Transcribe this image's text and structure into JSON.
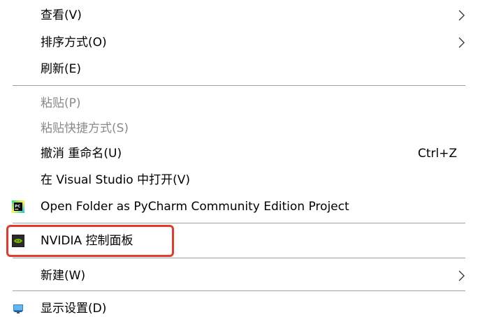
{
  "menu": {
    "items": [
      {
        "label": "查看(V)",
        "submenu": true
      },
      {
        "label": "排序方式(O)",
        "submenu": true
      },
      {
        "label": "刷新(E)"
      },
      {
        "label": "粘贴(P)",
        "disabled": true
      },
      {
        "label": "粘贴快捷方式(S)",
        "disabled": true
      },
      {
        "label": "撤消 重命名(U)",
        "shortcut": "Ctrl+Z"
      },
      {
        "label": "在 Visual Studio 中打开(V)"
      },
      {
        "label": "Open Folder as PyCharm Community Edition Project",
        "icon": "pycharm-icon"
      },
      {
        "label": "NVIDIA 控制面板",
        "icon": "nvidia-icon",
        "highlighted": true
      },
      {
        "label": "新建(W)",
        "submenu": true
      },
      {
        "label": "显示设置(D)",
        "icon": "display-settings-icon"
      }
    ]
  },
  "colors": {
    "highlight_border": "#e23b2e",
    "disabled_text": "#8a8a8a",
    "separator": "#a0a0a0"
  }
}
